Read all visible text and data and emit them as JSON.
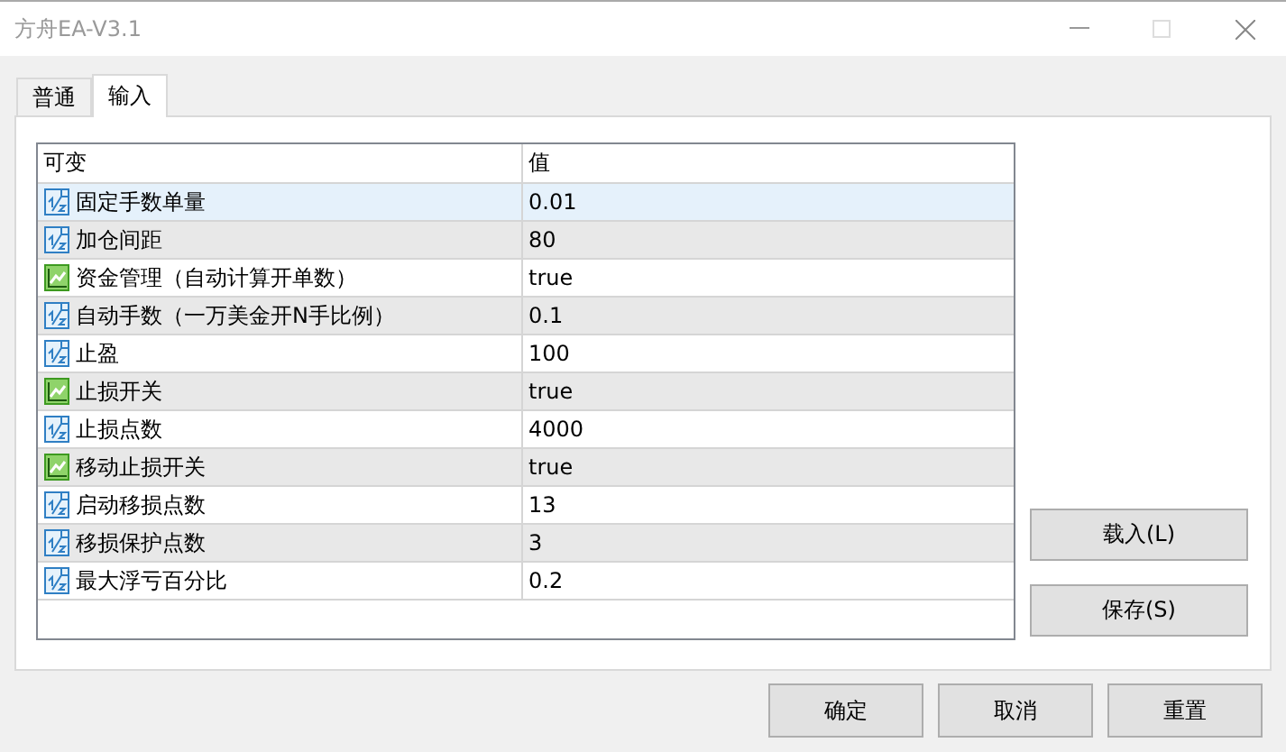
{
  "window": {
    "title": "方舟EA-V3.1"
  },
  "tabs": [
    {
      "label": "普通",
      "selected": false
    },
    {
      "label": "输入",
      "selected": true
    }
  ],
  "table": {
    "columns": [
      "可变",
      "值"
    ],
    "rows": [
      {
        "kind": "number",
        "name": "固定手数单量",
        "value": "0.01",
        "selected": true
      },
      {
        "kind": "number",
        "name": "加仓间距",
        "value": "80",
        "selected": false
      },
      {
        "kind": "bool",
        "name": "资金管理（自动计算开单数）",
        "value": "true",
        "selected": false
      },
      {
        "kind": "number",
        "name": "自动手数（一万美金开N手比例）",
        "value": "0.1",
        "selected": false
      },
      {
        "kind": "number",
        "name": "止盈",
        "value": "100",
        "selected": false
      },
      {
        "kind": "bool",
        "name": "止损开关",
        "value": "true",
        "selected": false
      },
      {
        "kind": "number",
        "name": "止损点数",
        "value": "4000",
        "selected": false
      },
      {
        "kind": "bool",
        "name": "移动止损开关",
        "value": "true",
        "selected": false
      },
      {
        "kind": "number",
        "name": "启动移损点数",
        "value": "13",
        "selected": false
      },
      {
        "kind": "number",
        "name": "移损保护点数",
        "value": "3",
        "selected": false
      },
      {
        "kind": "number",
        "name": "最大浮亏百分比",
        "value": "0.2",
        "selected": false
      }
    ]
  },
  "side_buttons": [
    "载入(L)",
    "保存(S)"
  ],
  "buttons": [
    "确定",
    "取消",
    "重置"
  ]
}
